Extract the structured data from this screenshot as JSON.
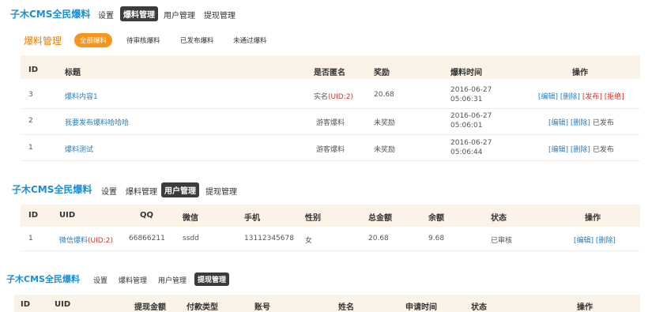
{
  "panel1": {
    "nav": {
      "brand": "子木CMS全民爆料",
      "items": [
        "设置",
        "爆料管理",
        "用户管理",
        "提现管理"
      ]
    },
    "section_title": "爆料管理",
    "filters": [
      "全部爆料",
      "待审核爆料",
      "已发布爆料",
      "未通过爆料"
    ],
    "columns": [
      "ID",
      "标题",
      "是否匿名",
      "奖励",
      "爆料时间",
      "操作"
    ],
    "rows": [
      {
        "id": "3",
        "title": "爆料内容1",
        "anon_prefix": "实名",
        "anon_uid": "(UID:2)",
        "reward": "20.68",
        "date": "2016-06-27",
        "time": "05:06:31",
        "actions": {
          "edit": "[编辑]",
          "delete": "[删除]",
          "publish": "[发布]",
          "reject": "[拒绝]"
        }
      },
      {
        "id": "2",
        "title": "我要发布爆料哈哈哈",
        "anon": "游客爆料",
        "reward": "未奖励",
        "date": "2016-06-27",
        "time": "05:06:01",
        "actions": {
          "edit": "[编辑]",
          "delete": "[删除]",
          "status": "已发布"
        }
      },
      {
        "id": "1",
        "title": "爆料测试",
        "anon": "游客爆料",
        "reward": "未奖励",
        "date": "2016-06-27",
        "time": "05:06:44",
        "actions": {
          "edit": "[编辑]",
          "delete": "[删除]",
          "status": "已发布"
        }
      }
    ]
  },
  "panel2": {
    "nav": {
      "brand": "子木CMS全民爆料",
      "items": [
        "设置",
        "爆料管理",
        "用户管理",
        "提现管理"
      ]
    },
    "columns": [
      "ID",
      "UID",
      "QQ",
      "微信",
      "手机",
      "性别",
      "总金额",
      "余额",
      "状态",
      "操作"
    ],
    "row": {
      "id": "1",
      "uid_name": "微信爆料",
      "uid_tag": "(UID:2)",
      "qq": "66866211",
      "wechat": "ssdd",
      "phone": "13112345678",
      "gender": "女",
      "total": "20.68",
      "balance": "9.68",
      "status": "已审核",
      "actions": {
        "edit": "[编辑]",
        "delete": "[删除]"
      }
    }
  },
  "panel3": {
    "nav": {
      "brand": "子木CMS全民爆料",
      "items": [
        "设置",
        "爆料管理",
        "用户管理",
        "提现管理"
      ]
    },
    "columns": [
      "ID",
      "UID",
      "提现金额",
      "付款类型",
      "账号",
      "姓名",
      "申请时间",
      "状态",
      "操作"
    ]
  }
}
